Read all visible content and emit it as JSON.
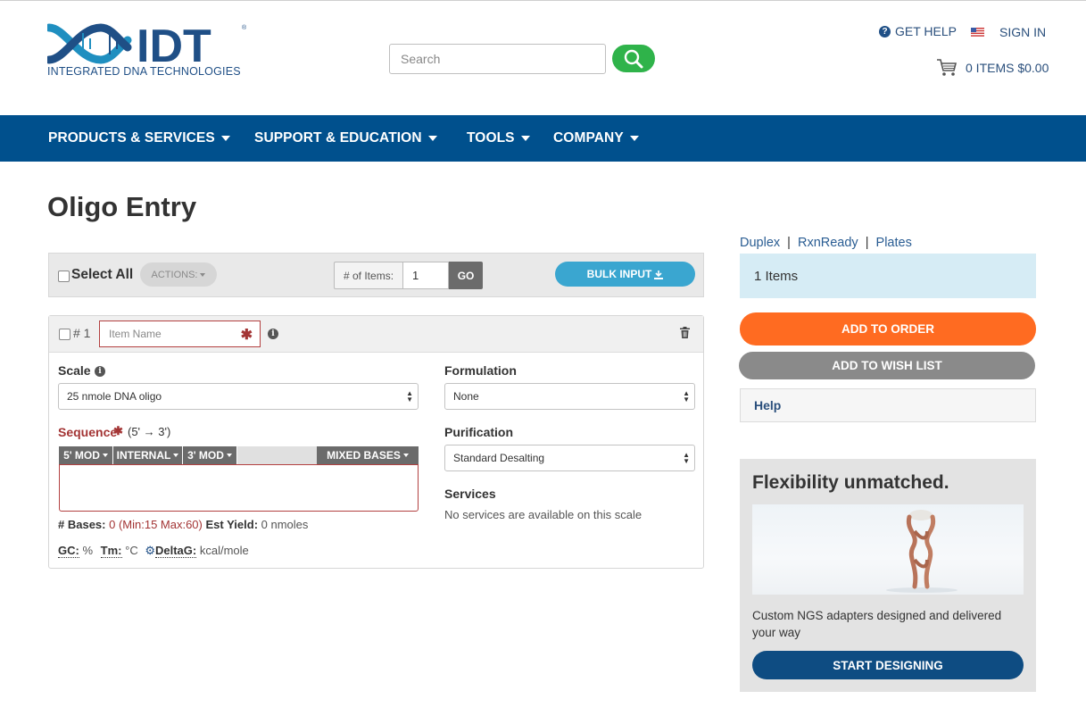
{
  "brand": {
    "logo_letters": "IDT",
    "name": "INTEGRATED DNA TECHNOLOGIES",
    "colors": {
      "primary": "#00508d",
      "accent": "#2fb34a",
      "order": "#ff6b21"
    }
  },
  "header": {
    "search_placeholder": "Search",
    "get_help": "GET HELP",
    "sign_in": "SIGN IN",
    "cart": "0 ITEMS $0.00"
  },
  "nav": {
    "items": [
      {
        "label": "PRODUCTS & SERVICES"
      },
      {
        "label": "SUPPORT & EDUCATION"
      },
      {
        "label": "TOOLS"
      },
      {
        "label": "COMPANY"
      }
    ]
  },
  "page": {
    "title": "Oligo Entry"
  },
  "toolbar": {
    "select_all": "Select All",
    "actions": "ACTIONS:",
    "num_items_label": "# of Items:",
    "num_items_value": "1",
    "go": "GO",
    "bulk_input": "BULK INPUT"
  },
  "item": {
    "number": "# 1",
    "name_placeholder": "Item Name",
    "scale_label": "Scale",
    "scale_value": "25 nmole DNA oligo",
    "sequence_label": "Sequence",
    "sequence_direction": "(5' → 3')",
    "mods": [
      "5' MOD",
      "INTERNAL",
      "3' MOD",
      "MIXED BASES"
    ],
    "bases_label": "# Bases:",
    "bases_value": "0 (Min:15 Max:60)",
    "yield_label": "Est Yield:",
    "yield_value": "0 nmoles",
    "gc_label": "GC:",
    "gc_unit": "%",
    "tm_label": "Tm:",
    "tm_unit": "°C",
    "deltag_label": "DeltaG:",
    "deltag_unit": "kcal/mole",
    "formulation_label": "Formulation",
    "formulation_value": "None",
    "purification_label": "Purification",
    "purification_value": "Standard Desalting",
    "services_label": "Services",
    "services_text": "No services are available on this scale"
  },
  "sidebar": {
    "links": [
      "Duplex",
      "RxnReady",
      "Plates"
    ],
    "items_count": "1 Items",
    "add_to_order": "ADD TO ORDER",
    "add_to_wishlist": "ADD TO WISH LIST",
    "help": "Help",
    "promo_title": "Flexibility unmatched.",
    "promo_text": "Custom NGS adapters designed and delivered your way",
    "promo_button": "START DESIGNING"
  }
}
